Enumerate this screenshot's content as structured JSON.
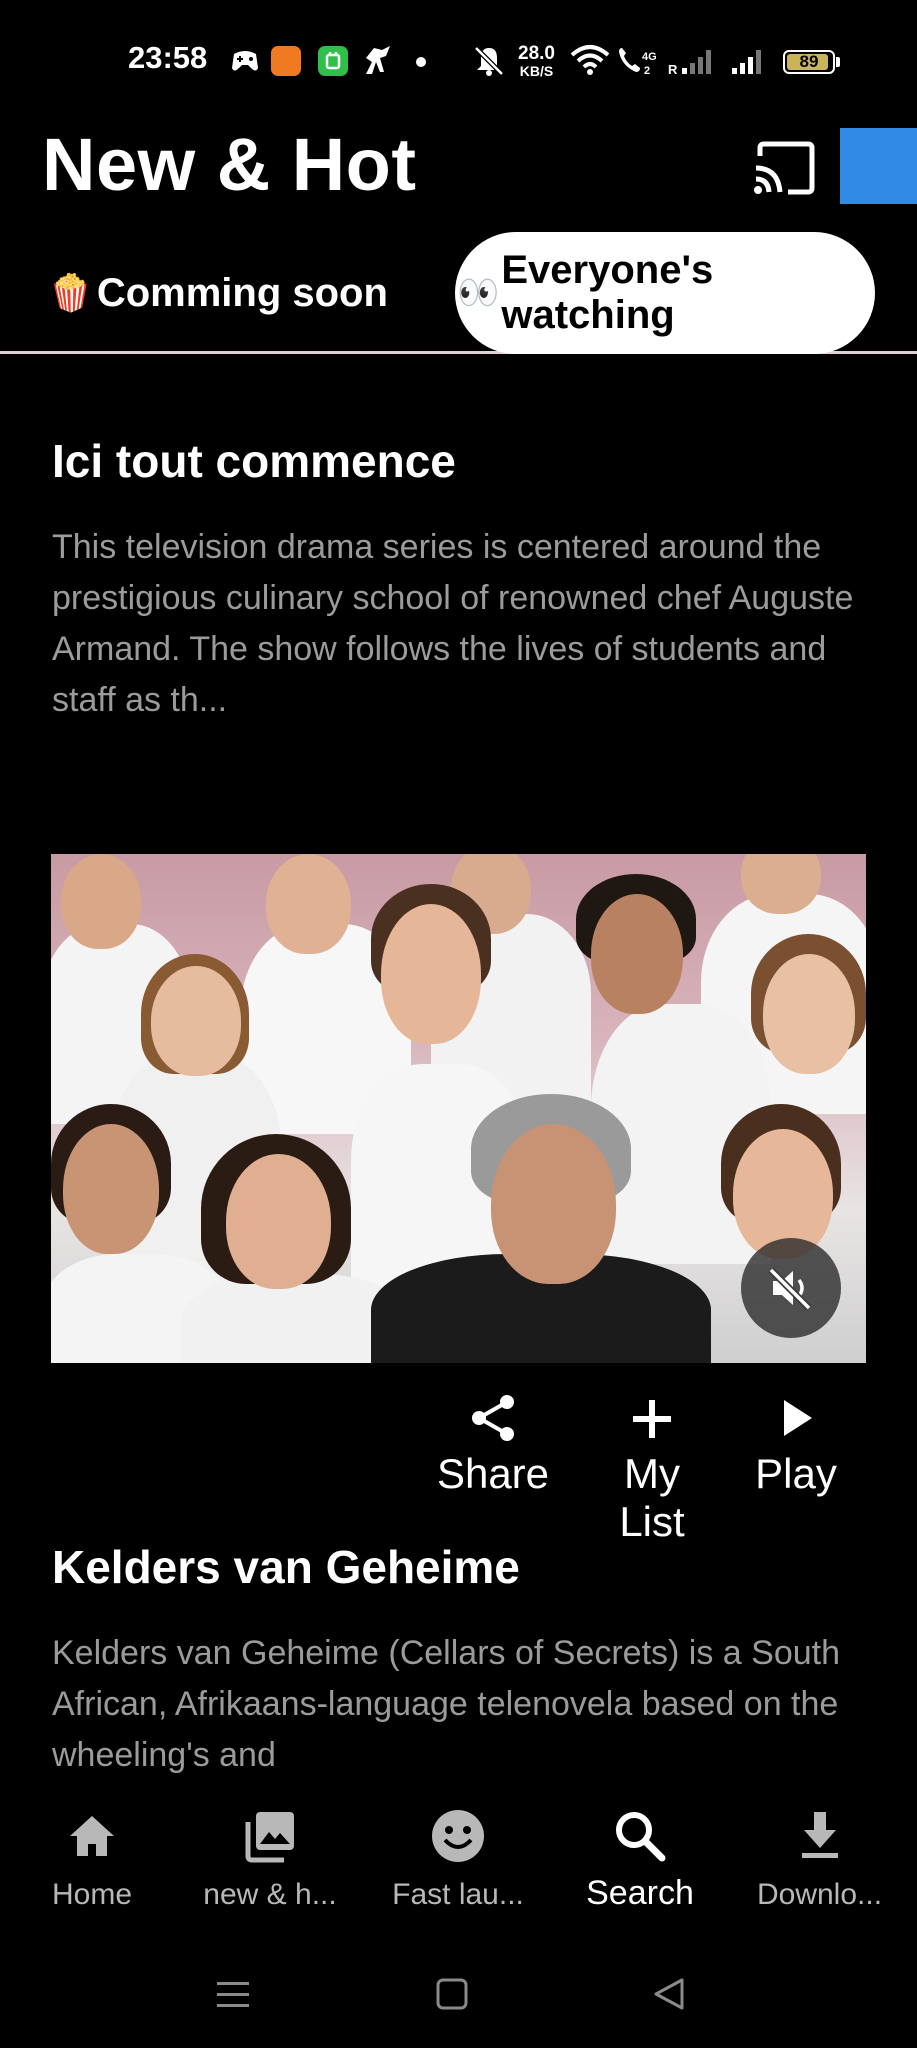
{
  "status_bar": {
    "time": "23:58",
    "network_speed_value": "28.0",
    "network_speed_unit": "KB/S",
    "battery": "89",
    "icons": [
      "gamepad-icon",
      "temu-app-icon",
      "green-app-icon",
      "horse-app-icon",
      "dot-icon",
      "mute-bell-icon",
      "wifi-icon",
      "volte-call-icon",
      "signal-r-icon",
      "signal-icon",
      "battery-icon"
    ]
  },
  "header": {
    "title": "New & Hot",
    "cast_icon": "cast-icon"
  },
  "tabs": [
    {
      "emoji": "🍿",
      "label": "Comming soon",
      "active": false
    },
    {
      "emoji": "👀",
      "label": "Everyone's watching",
      "active": true
    }
  ],
  "shows": [
    {
      "title": "Ici tout commence",
      "description": "This television drama series is centered around the prestigious culinary school of renowned chef Auguste Armand. The show follows the lives of students and staff as th..."
    },
    {
      "title": "Kelders van Geheime",
      "description": "Kelders van Geheime (Cellars of Secrets) is a South African, Afrikaans-language telenovela based on the wheeling's and"
    }
  ],
  "actions": [
    {
      "label": "Share",
      "icon": "share-icon"
    },
    {
      "label": "My List",
      "icon": "plus-icon"
    },
    {
      "label": "Play",
      "icon": "play-icon"
    }
  ],
  "bottom_nav": [
    {
      "label": "Home",
      "icon": "home-icon",
      "active": false
    },
    {
      "label": "new & h...",
      "icon": "gallery-icon",
      "active": false
    },
    {
      "label": "Fast lau...",
      "icon": "smiley-icon",
      "active": false
    },
    {
      "label": "Search",
      "icon": "search-icon",
      "active": true
    },
    {
      "label": "Downlo...",
      "icon": "download-icon",
      "active": false
    }
  ],
  "colors": {
    "background": "#000000",
    "accent_blue": "#2f8be6",
    "description_gray": "#9b9b9b",
    "tab_divider": "#e3cfd6"
  }
}
